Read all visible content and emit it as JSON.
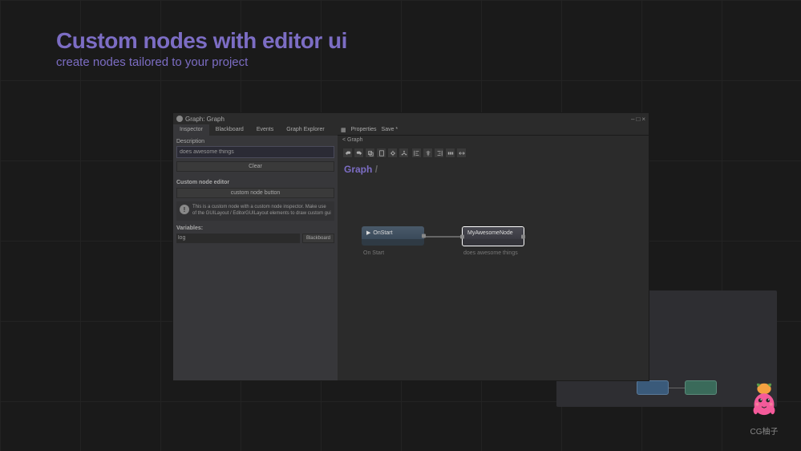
{
  "heading": {
    "title": "Custom nodes with editor ui",
    "subtitle": "create nodes tailored to your project"
  },
  "window": {
    "title": "Graph: Graph",
    "controls": {
      "min": "‒",
      "max": "□",
      "close": "×"
    }
  },
  "tabs": {
    "inspector": "Inspector",
    "blackboard": "Blackboard",
    "events": "Events",
    "explorer": "Graph Explorer"
  },
  "inspector": {
    "description_label": "Description",
    "description_value": "does awesome things",
    "clear": "Clear",
    "custom_header": "Custom node editor",
    "custom_button": "custom node button",
    "info_text": "This is a custom node with a custom node inspector. Make use of the GUILayout / EditorGUILayout elements to draw custom gui",
    "variables_header": "Variables:",
    "var_name": "log",
    "var_bb": "Blackboard"
  },
  "properties": {
    "label": "Properties",
    "save": "Save *",
    "breadcrumb": "< Graph"
  },
  "graph": {
    "title": "Graph",
    "slash": "/",
    "nodes": {
      "start": {
        "label": "OnStart",
        "caption": "On Start"
      },
      "awesome": {
        "label": "MyAwesomeNode",
        "caption": "does awesome things"
      }
    }
  },
  "mascot": {
    "label": "CG柚子"
  }
}
